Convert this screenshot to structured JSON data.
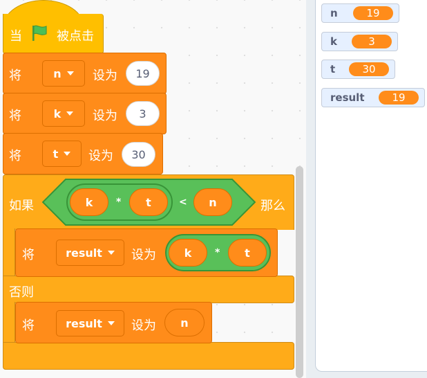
{
  "script": {
    "hat": {
      "prefix": "当",
      "suffix": "被点击",
      "icon": "green-flag-icon"
    },
    "set_blocks": [
      {
        "label": "将",
        "variable": "n",
        "to_label": "设为",
        "value": "19"
      },
      {
        "label": "将",
        "variable": "k",
        "to_label": "设为",
        "value": "3"
      },
      {
        "label": "将",
        "variable": "t",
        "to_label": "设为",
        "value": "30"
      }
    ],
    "if_else": {
      "if_label": "如果",
      "then_label": "那么",
      "else_label": "否则",
      "condition": {
        "left": "k",
        "mult": "*",
        "right": "t",
        "lt": "<",
        "compare": "n"
      },
      "then_block": {
        "label": "将",
        "variable": "result",
        "to_label": "设为",
        "left": "k",
        "mult": "*",
        "right": "t"
      },
      "else_block": {
        "label": "将",
        "variable": "result",
        "to_label": "设为",
        "value": "n"
      }
    }
  },
  "monitors": [
    {
      "name": "n",
      "value": "19"
    },
    {
      "name": "k",
      "value": "3"
    },
    {
      "name": "t",
      "value": "30"
    },
    {
      "name": "result",
      "value": "19"
    }
  ],
  "colors": {
    "events": "#ffbf00",
    "data": "#ff8c1a",
    "control": "#ffab19",
    "operators": "#59c059"
  }
}
